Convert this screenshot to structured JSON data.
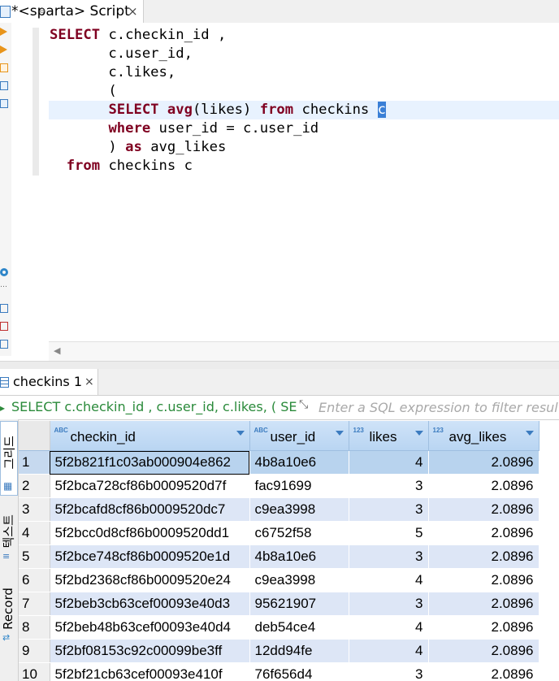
{
  "editor_tab": {
    "title": "*<sparta> Script",
    "close": "×"
  },
  "sql": {
    "lines": [
      [
        {
          "t": "SELECT",
          "k": 1
        },
        {
          "t": " c.checkin_id ,"
        }
      ],
      [
        {
          "t": "       c.user_id,"
        }
      ],
      [
        {
          "t": "       c.likes,"
        }
      ],
      [
        {
          "t": "       ("
        }
      ],
      [
        {
          "t": "       "
        },
        {
          "t": "SELECT",
          "k": 1
        },
        {
          "t": " "
        },
        {
          "t": "avg",
          "k": 1
        },
        {
          "t": "(likes) "
        },
        {
          "t": "from",
          "k": 1
        },
        {
          "t": " checkins "
        },
        {
          "t": "c",
          "sel": 1
        }
      ],
      [
        {
          "t": "       "
        },
        {
          "t": "where",
          "k": 1
        },
        {
          "t": " user_id = c.user_id"
        }
      ],
      [
        {
          "t": "       ) "
        },
        {
          "t": "as",
          "k": 1
        },
        {
          "t": " avg_likes"
        }
      ],
      [
        {
          "t": "  "
        },
        {
          "t": "from",
          "k": 1
        },
        {
          "t": " checkins c"
        }
      ]
    ]
  },
  "results_tab": {
    "title": "checkins 1",
    "close": "×"
  },
  "filter": {
    "query_text": "SELECT c.checkin_id , c.user_id, c.likes, ( SE",
    "placeholder": "Enter a SQL expression to filter results"
  },
  "side_panel": {
    "grid_label": "그리드",
    "text_label": "텍스트",
    "record_label": "Record"
  },
  "grid": {
    "columns": [
      {
        "type": "ABC",
        "label": "checkin_id"
      },
      {
        "type": "ABC",
        "label": "user_id"
      },
      {
        "type": "123",
        "label": "likes"
      },
      {
        "type": "123",
        "label": "avg_likes"
      }
    ],
    "rows": [
      {
        "n": "1",
        "checkin_id": "5f2b821f1c03ab000904e862",
        "user_id": "4b8a10e6",
        "likes": "4",
        "avg_likes": "2.0896"
      },
      {
        "n": "2",
        "checkin_id": "5f2bca728cf86b0009520d7f",
        "user_id": "fac91699",
        "likes": "3",
        "avg_likes": "2.0896"
      },
      {
        "n": "3",
        "checkin_id": "5f2bcafd8cf86b0009520dc7",
        "user_id": "c9ea3998",
        "likes": "3",
        "avg_likes": "2.0896"
      },
      {
        "n": "4",
        "checkin_id": "5f2bcc0d8cf86b0009520dd1",
        "user_id": "c6752f58",
        "likes": "5",
        "avg_likes": "2.0896"
      },
      {
        "n": "5",
        "checkin_id": "5f2bce748cf86b0009520e1d",
        "user_id": "4b8a10e6",
        "likes": "3",
        "avg_likes": "2.0896"
      },
      {
        "n": "6",
        "checkin_id": "5f2bd2368cf86b0009520e24",
        "user_id": "c9ea3998",
        "likes": "4",
        "avg_likes": "2.0896"
      },
      {
        "n": "7",
        "checkin_id": "5f2beb3cb63cef00093e40d3",
        "user_id": "95621907",
        "likes": "3",
        "avg_likes": "2.0896"
      },
      {
        "n": "8",
        "checkin_id": "5f2beb48b63cef00093e40d4",
        "user_id": "deb54ce4",
        "likes": "4",
        "avg_likes": "2.0896"
      },
      {
        "n": "9",
        "checkin_id": "5f2bf08153c92c00099be3ff",
        "user_id": "12dd94fe",
        "likes": "4",
        "avg_likes": "2.0896"
      },
      {
        "n": "10",
        "checkin_id": "5f2bf21cb63cef00093e410f",
        "user_id": "76f656d4",
        "likes": "3",
        "avg_likes": "2.0896"
      }
    ]
  }
}
